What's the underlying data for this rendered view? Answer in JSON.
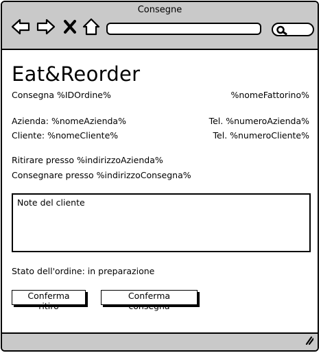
{
  "window": {
    "title": "Consegne"
  },
  "toolbar": {
    "icons": [
      "back-arrow-icon",
      "forward-arrow-icon",
      "close-icon",
      "home-icon",
      "search-icon"
    ],
    "url_value": ""
  },
  "order": {
    "app_title": "Eat&Reorder",
    "delivery_id": "Consegna %IDOrdine%",
    "courier_name": "%nomeFattorino%",
    "company": "Azienda: %nomeAzienda%",
    "company_phone": "Tel. %numeroAzienda%",
    "customer": "Cliente: %nomeCliente%",
    "customer_phone": "Tel. %numeroCliente%",
    "pickup": "Ritirare presso %indirizzoAzienda%",
    "dropoff": "Consegnare presso %indirizzoConsegna%",
    "notes_label": "Note del cliente",
    "status": "Stato dell'ordine: in preparazione"
  },
  "actions": {
    "confirm_pickup": "Conferma ritiro",
    "confirm_delivery": "Conferma consegna"
  }
}
